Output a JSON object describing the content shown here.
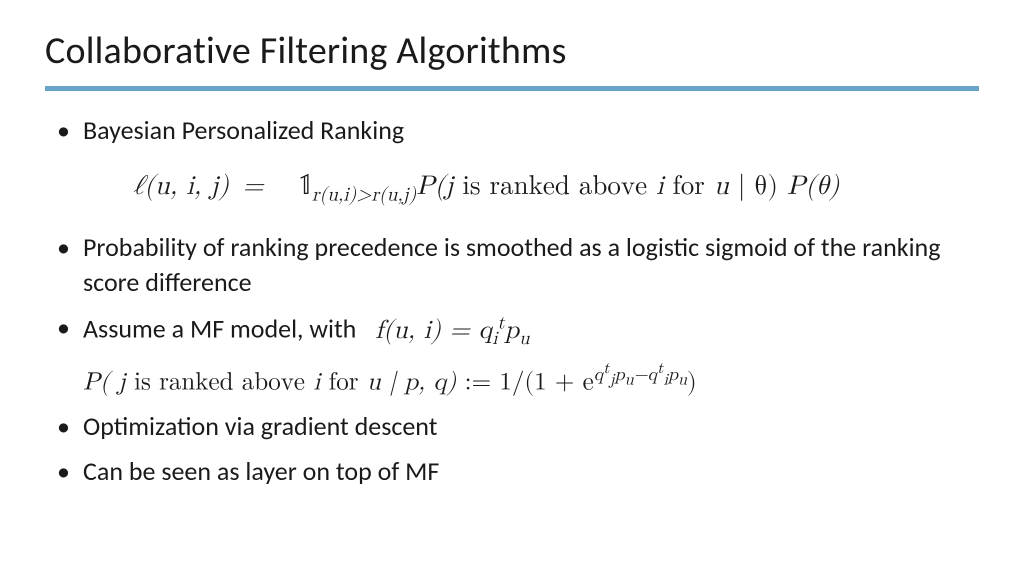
{
  "title": "Collaborative Filtering Algorithms",
  "b1": "Bayesian Personalized Ranking",
  "eq1_left": "ℓ(u, i, j) =",
  "eq1_ind": "𝟙",
  "eq1_sub": "r(u,i)>r(u,j)",
  "eq1_p": "P(j",
  "eq1_text": " is ranked above ",
  "eq1_ifor": "i",
  "eq1_for": " for ",
  "eq1_u": "u",
  "eq1_bar": " | θ)",
  "eq1_ptheta": " P(θ)",
  "b2": "Probability of ranking precedence is smoothed as a logistic sigmoid of the ranking score difference",
  "b3_pre": "Assume a MF model, with  ",
  "eq3_f": "f(u, i) = q",
  "eq3_sub_i": "i",
  "eq3_sup_t": "t",
  "eq3_p": "p",
  "eq3_sub_u": "u",
  "eq4_p": "P( j",
  "eq4_txt": " is ranked above ",
  "eq4_i": "i",
  "eq4_for": " for ",
  "eq4_u": "u",
  "eq4_bar": " | p, q)",
  "eq4_def": " := 1/(1 + e",
  "eq4_exp_a": "q",
  "eq4_exp_b": "p",
  "eq4_close": ")",
  "b5": "Optimization via gradient descent",
  "b6": "Can be seen as layer on top of MF"
}
